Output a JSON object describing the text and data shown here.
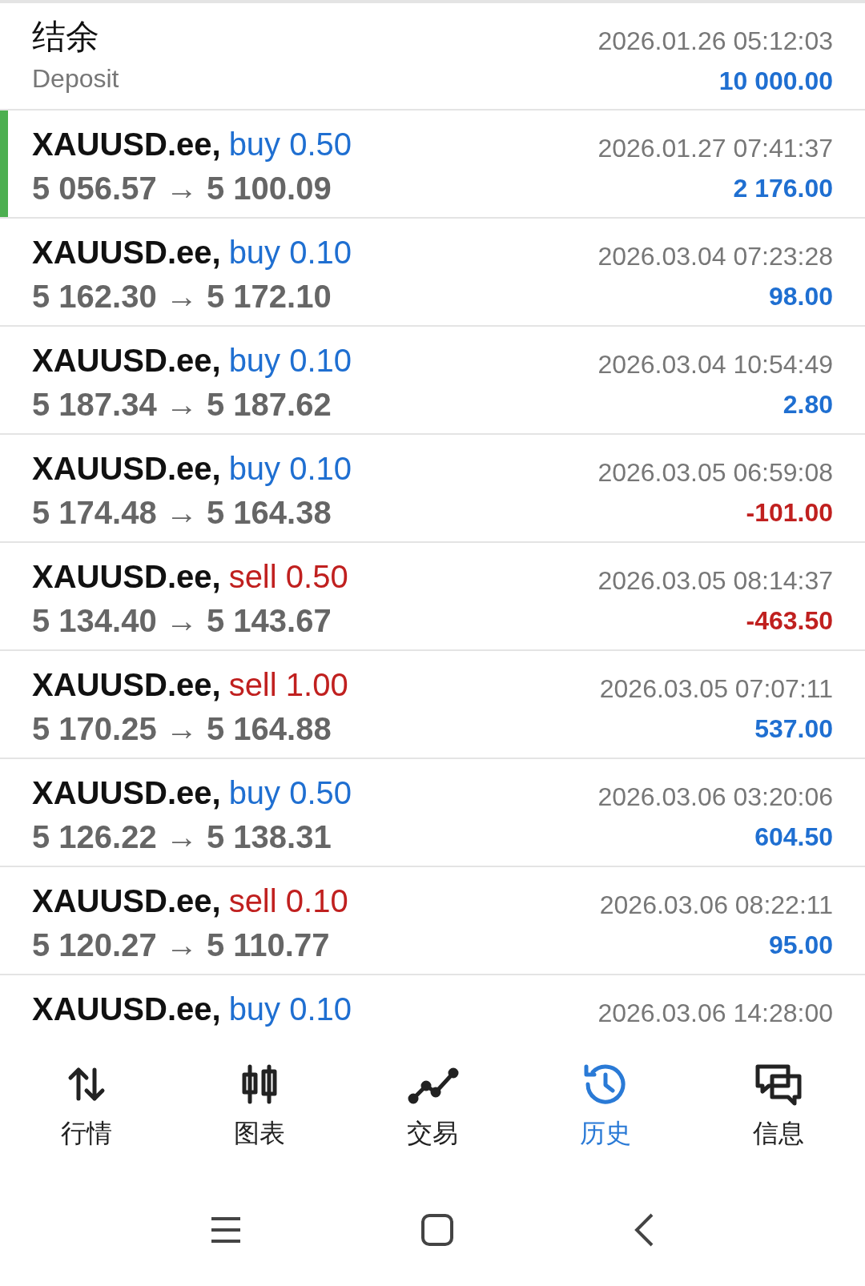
{
  "balance": {
    "title": "结余",
    "subtitle": "Deposit",
    "time": "2026.01.26 05:12:03",
    "amount": "10 000.00"
  },
  "deals": [
    {
      "symbol": "XAUUSD.ee,",
      "kind": "buy",
      "side": "buy",
      "lots": "0.50",
      "prices": "5 056.57 → 5 100.09",
      "time": "2026.01.27 07:41:37",
      "profit": "2 176.00",
      "loss": false,
      "selected": true
    },
    {
      "symbol": "XAUUSD.ee,",
      "kind": "buy",
      "side": "buy",
      "lots": "0.10",
      "prices": "5 162.30 → 5 172.10",
      "time": "2026.03.04 07:23:28",
      "profit": "98.00",
      "loss": false,
      "selected": false
    },
    {
      "symbol": "XAUUSD.ee,",
      "kind": "buy",
      "side": "buy",
      "lots": "0.10",
      "prices": "5 187.34 → 5 187.62",
      "time": "2026.03.04 10:54:49",
      "profit": "2.80",
      "loss": false,
      "selected": false
    },
    {
      "symbol": "XAUUSD.ee,",
      "kind": "buy",
      "side": "buy",
      "lots": "0.10",
      "prices": "5 174.48 → 5 164.38",
      "time": "2026.03.05 06:59:08",
      "profit": "-101.00",
      "loss": true,
      "selected": false
    },
    {
      "symbol": "XAUUSD.ee,",
      "kind": "sell",
      "side": "sell",
      "lots": "0.50",
      "prices": "5 134.40 → 5 143.67",
      "time": "2026.03.05 08:14:37",
      "profit": "-463.50",
      "loss": true,
      "selected": false
    },
    {
      "symbol": "XAUUSD.ee,",
      "kind": "sell",
      "side": "sell",
      "lots": "1.00",
      "prices": "5 170.25 → 5 164.88",
      "time": "2026.03.05 07:07:11",
      "profit": "537.00",
      "loss": false,
      "selected": false
    },
    {
      "symbol": "XAUUSD.ee,",
      "kind": "buy",
      "side": "buy",
      "lots": "0.50",
      "prices": "5 126.22 → 5 138.31",
      "time": "2026.03.06 03:20:06",
      "profit": "604.50",
      "loss": false,
      "selected": false
    },
    {
      "symbol": "XAUUSD.ee,",
      "kind": "sell",
      "side": "sell",
      "lots": "0.10",
      "prices": "5 120.27 → 5 110.77",
      "time": "2026.03.06 08:22:11",
      "profit": "95.00",
      "loss": false,
      "selected": false
    },
    {
      "symbol": "XAUUSD.ee,",
      "kind": "buy",
      "side": "buy",
      "lots": "0.10",
      "time": "2026.03.06 14:28:00",
      "selected": false
    }
  ],
  "tabs": [
    {
      "kind": "quotes",
      "label": "行情",
      "selected": false
    },
    {
      "kind": "chart",
      "label": "图表",
      "selected": false
    },
    {
      "kind": "trade",
      "label": "交易",
      "selected": false
    },
    {
      "kind": "history",
      "label": "历史",
      "selected": true
    },
    {
      "kind": "messages",
      "label": "信息",
      "selected": false
    }
  ]
}
